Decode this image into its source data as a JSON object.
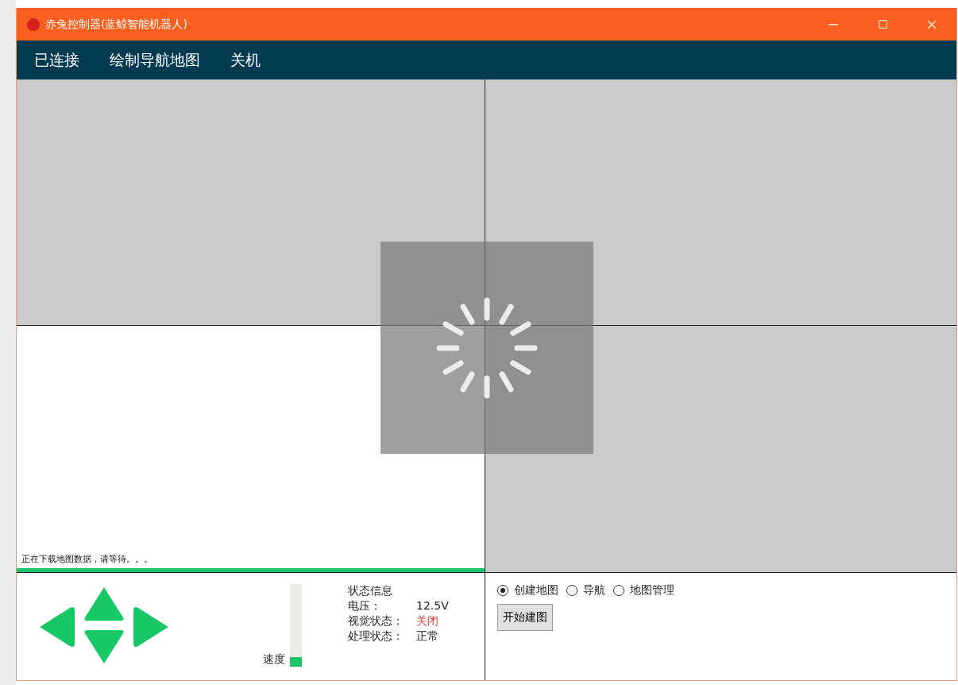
{
  "window": {
    "title": "赤兔控制器(蓝鲸智能机器人)"
  },
  "menu": [
    {
      "label": "已连接"
    },
    {
      "label": "绘制导航地图"
    },
    {
      "label": "关机"
    }
  ],
  "map": {
    "loading": true,
    "status_text": "正在下载地图数据，请等待。。。",
    "progress": {
      "level": 1
    }
  },
  "speed": {
    "label": "速度",
    "level": 0.12
  },
  "status": {
    "title": "状态信息",
    "rows": [
      {
        "label": "电压：",
        "value": "12.5V",
        "alert": false
      },
      {
        "label": "视觉状态：",
        "value": "关闭",
        "alert": true
      },
      {
        "label": "处理状态：",
        "value": "正常",
        "alert": false
      }
    ]
  },
  "modes": [
    {
      "label": "创建地图",
      "selected": true
    },
    {
      "label": "导航",
      "selected": false
    },
    {
      "label": "地图管理",
      "selected": false
    }
  ],
  "action_button": "开始建图"
}
